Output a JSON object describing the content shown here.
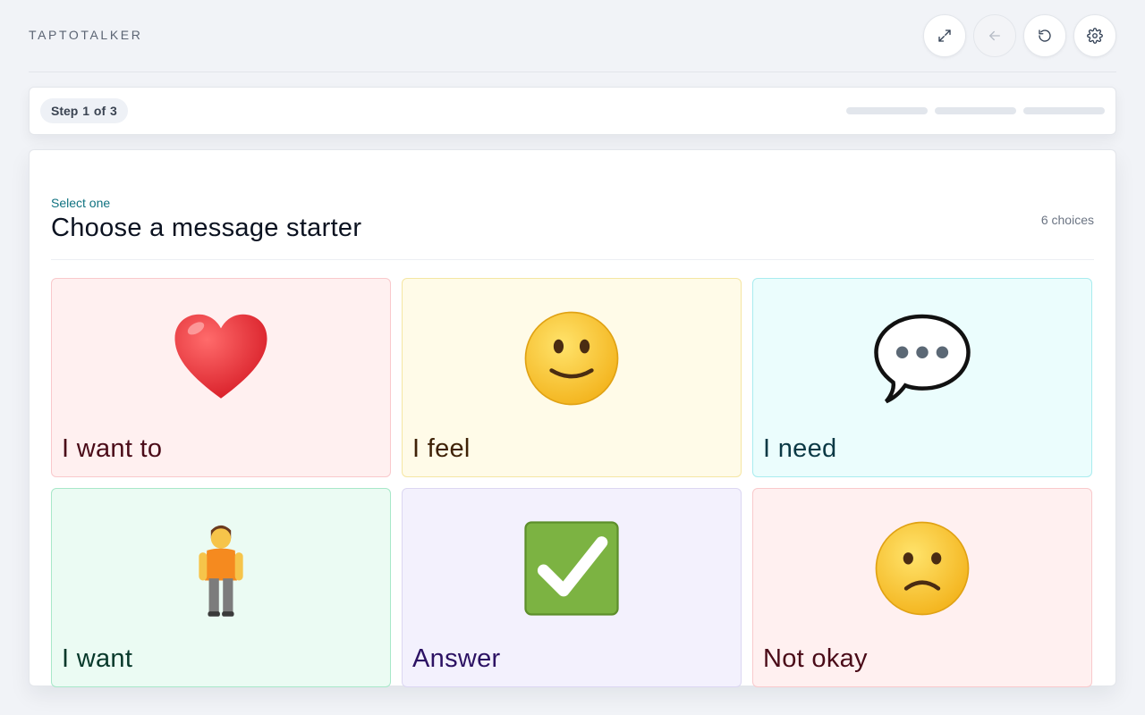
{
  "app": {
    "brand": "TAPTOTALKER"
  },
  "toolbar": {
    "buttons": [
      {
        "icon": "expand-icon",
        "enabled": true
      },
      {
        "icon": "back-arrow-icon",
        "enabled": false
      },
      {
        "icon": "reset-icon",
        "enabled": true
      },
      {
        "icon": "gear-icon",
        "enabled": true
      }
    ]
  },
  "stepper": {
    "label": "Step 1 of 3",
    "current": 1,
    "total": 3
  },
  "main": {
    "eyebrow": "Select one",
    "title": "Choose a message starter",
    "count": "6 choices"
  },
  "choices": [
    {
      "label": "I want to",
      "icon": "red-heart-icon",
      "color": "#fff0f0"
    },
    {
      "label": "I feel",
      "icon": "smiling-face-icon",
      "color": "#fffbe8"
    },
    {
      "label": "I need",
      "icon": "speech-bubble-icon",
      "color": "#ebfdfd"
    },
    {
      "label": "I want",
      "icon": "person-standing-icon",
      "color": "#ebfbf3"
    },
    {
      "label": "Answer",
      "icon": "check-mark-button-icon",
      "color": "#f3f1fd"
    },
    {
      "label": "Not okay",
      "icon": "frowning-face-icon",
      "color": "#fff0f0"
    }
  ]
}
